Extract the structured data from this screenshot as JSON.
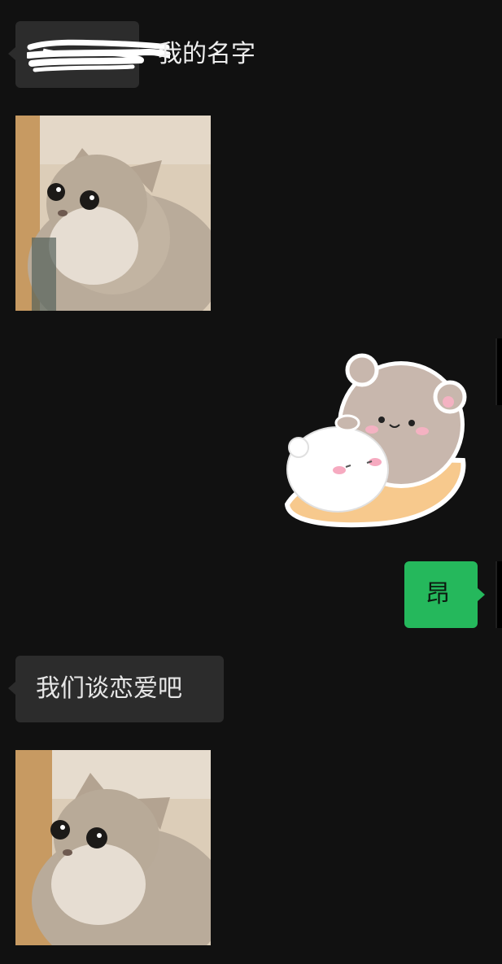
{
  "messages": [
    {
      "side": "received",
      "text": "我的名字",
      "note_icon": "redacted-name"
    },
    {
      "side": "received",
      "type": "image",
      "image": "cat-photo"
    },
    {
      "side": "sent",
      "type": "sticker",
      "image": "bears-hugging-sticker"
    },
    {
      "side": "sent",
      "text": "昂"
    },
    {
      "side": "received",
      "text": "我们谈恋爱吧"
    },
    {
      "side": "received",
      "type": "image",
      "image": "cat-photo"
    }
  ],
  "colors": {
    "background": "#111111",
    "received_bubble": "#2c2c2c",
    "sent_bubble": "#25b85c"
  }
}
